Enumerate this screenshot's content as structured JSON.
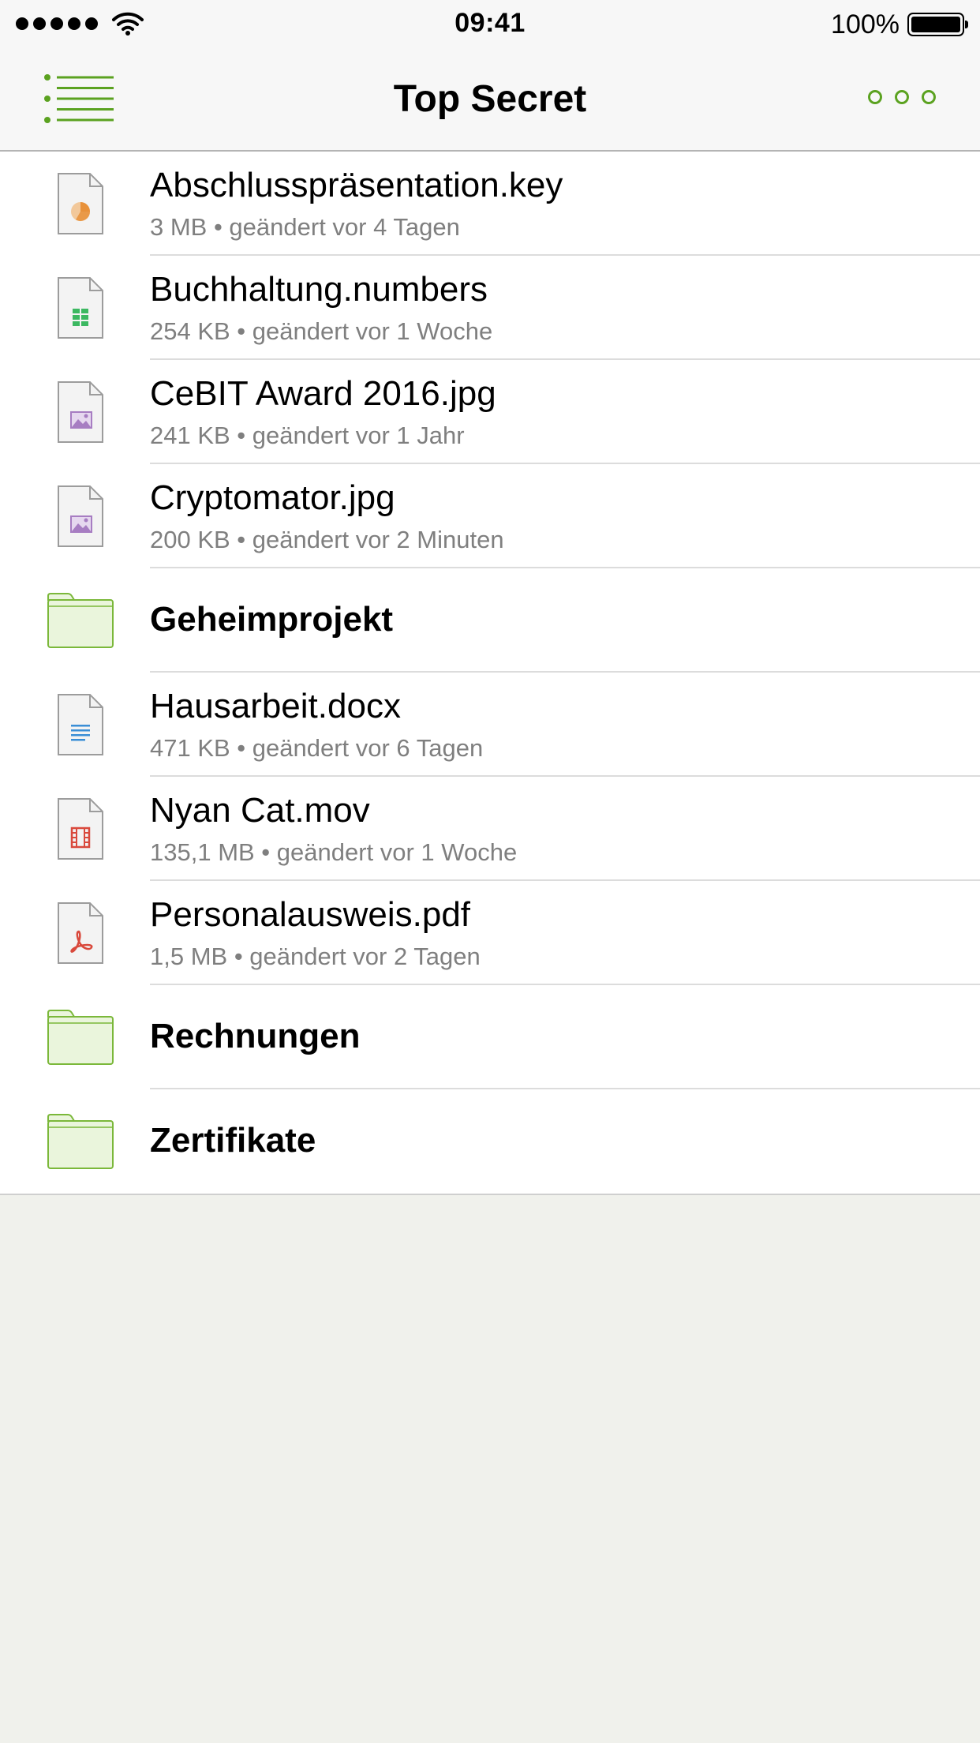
{
  "status_bar": {
    "time": "09:41",
    "battery_percent": "100%",
    "signal_bars": 5,
    "battery_level": 1.0
  },
  "nav": {
    "title": "Top Secret",
    "menu_icon": "list-menu-icon",
    "more_icon": "more-options-icon"
  },
  "colors": {
    "accent": "#5ba220",
    "folder_fill": "#eaf5dc",
    "folder_stroke": "#7bb83a",
    "keynote": "#e8913a",
    "numbers": "#3cb861",
    "image": "#a77dc2",
    "word": "#3a8ed6",
    "video": "#d9493c",
    "pdf": "#d9493c",
    "meta_text": "#7f7f7f"
  },
  "items": [
    {
      "type": "file",
      "icon": "keynote-file-icon",
      "name": "Abschlusspräsentation.key",
      "meta": "3 MB • geändert vor 4 Tagen"
    },
    {
      "type": "file",
      "icon": "numbers-file-icon",
      "name": "Buchhaltung.numbers",
      "meta": "254 KB • geändert vor 1 Woche"
    },
    {
      "type": "file",
      "icon": "image-file-icon",
      "name": "CeBIT Award 2016.jpg",
      "meta": "241 KB • geändert vor 1 Jahr"
    },
    {
      "type": "file",
      "icon": "image-file-icon",
      "name": "Cryptomator.jpg",
      "meta": "200 KB • geändert vor 2 Minuten"
    },
    {
      "type": "folder",
      "icon": "folder-icon",
      "name": "Geheimprojekt"
    },
    {
      "type": "file",
      "icon": "document-file-icon",
      "name": "Hausarbeit.docx",
      "meta": "471 KB • geändert vor 6 Tagen"
    },
    {
      "type": "file",
      "icon": "video-file-icon",
      "name": "Nyan Cat.mov",
      "meta": "135,1 MB • geändert vor 1 Woche"
    },
    {
      "type": "file",
      "icon": "pdf-file-icon",
      "name": "Personalausweis.pdf",
      "meta": "1,5 MB • geändert vor 2 Tagen"
    },
    {
      "type": "folder",
      "icon": "folder-icon",
      "name": "Rechnungen"
    },
    {
      "type": "folder",
      "icon": "folder-icon",
      "name": "Zertifikate"
    }
  ]
}
